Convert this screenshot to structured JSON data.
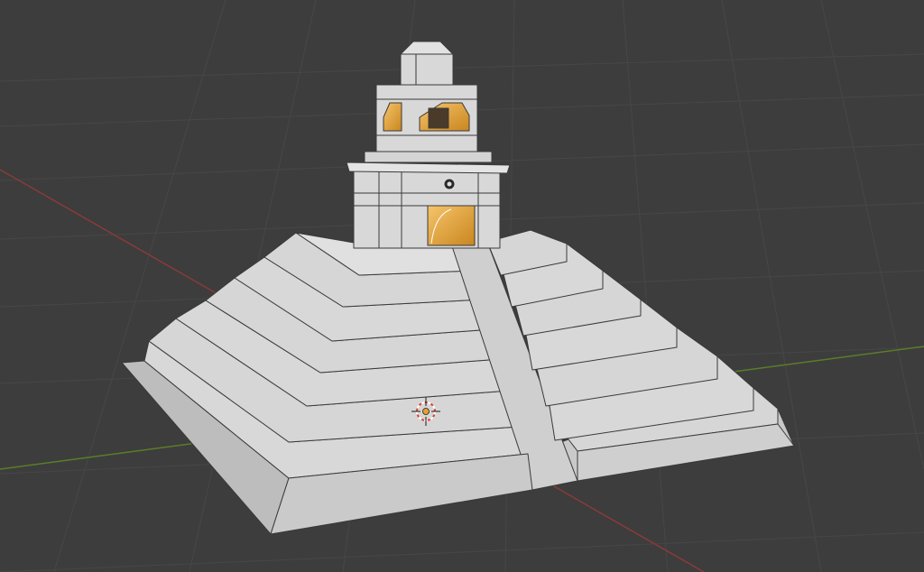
{
  "viewport": {
    "background": "#3d3d3d",
    "grid_color": "#474747",
    "x_axis_color": "#8a3a3a",
    "y_axis_color": "#5a7d2a"
  },
  "model": {
    "stone_color": "#d6d6d6",
    "stone_shade": "#bdbdbd",
    "edge_color": "#3a3a3a",
    "interior_glow": "#f0b03a"
  },
  "icons": {
    "origin": "3d-cursor-icon",
    "light": "light-object-icon"
  }
}
